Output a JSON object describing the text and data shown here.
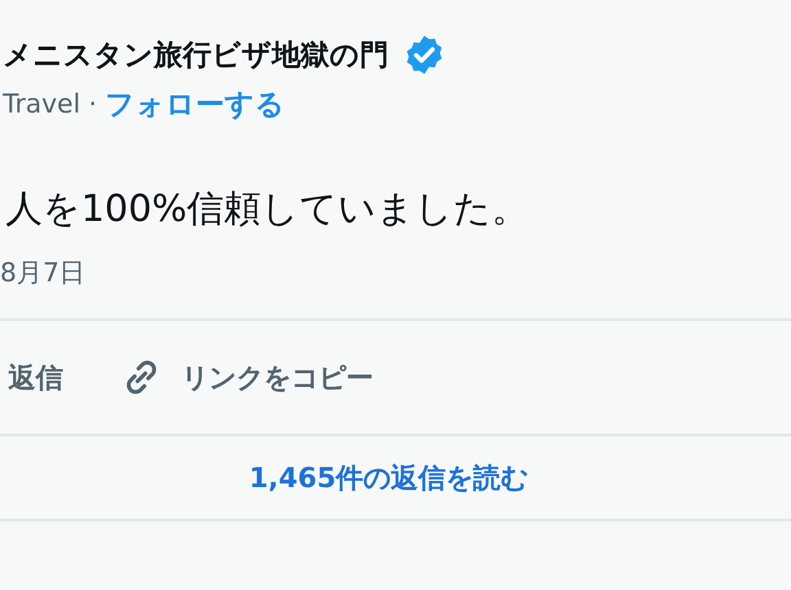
{
  "author": {
    "name": "メニスタン旅行ビザ地獄の門",
    "verified": true,
    "handle": "Travel",
    "separator": "·",
    "follow": "フォローする"
  },
  "tweet": {
    "text": "人を100%信頼していました。",
    "date": "8月7日"
  },
  "actions": [
    {
      "kind": "reply",
      "label": "返信"
    },
    {
      "kind": "copy-link",
      "label": "リンクをコピー"
    }
  ],
  "read_replies": "1,465件の返信を読む"
}
